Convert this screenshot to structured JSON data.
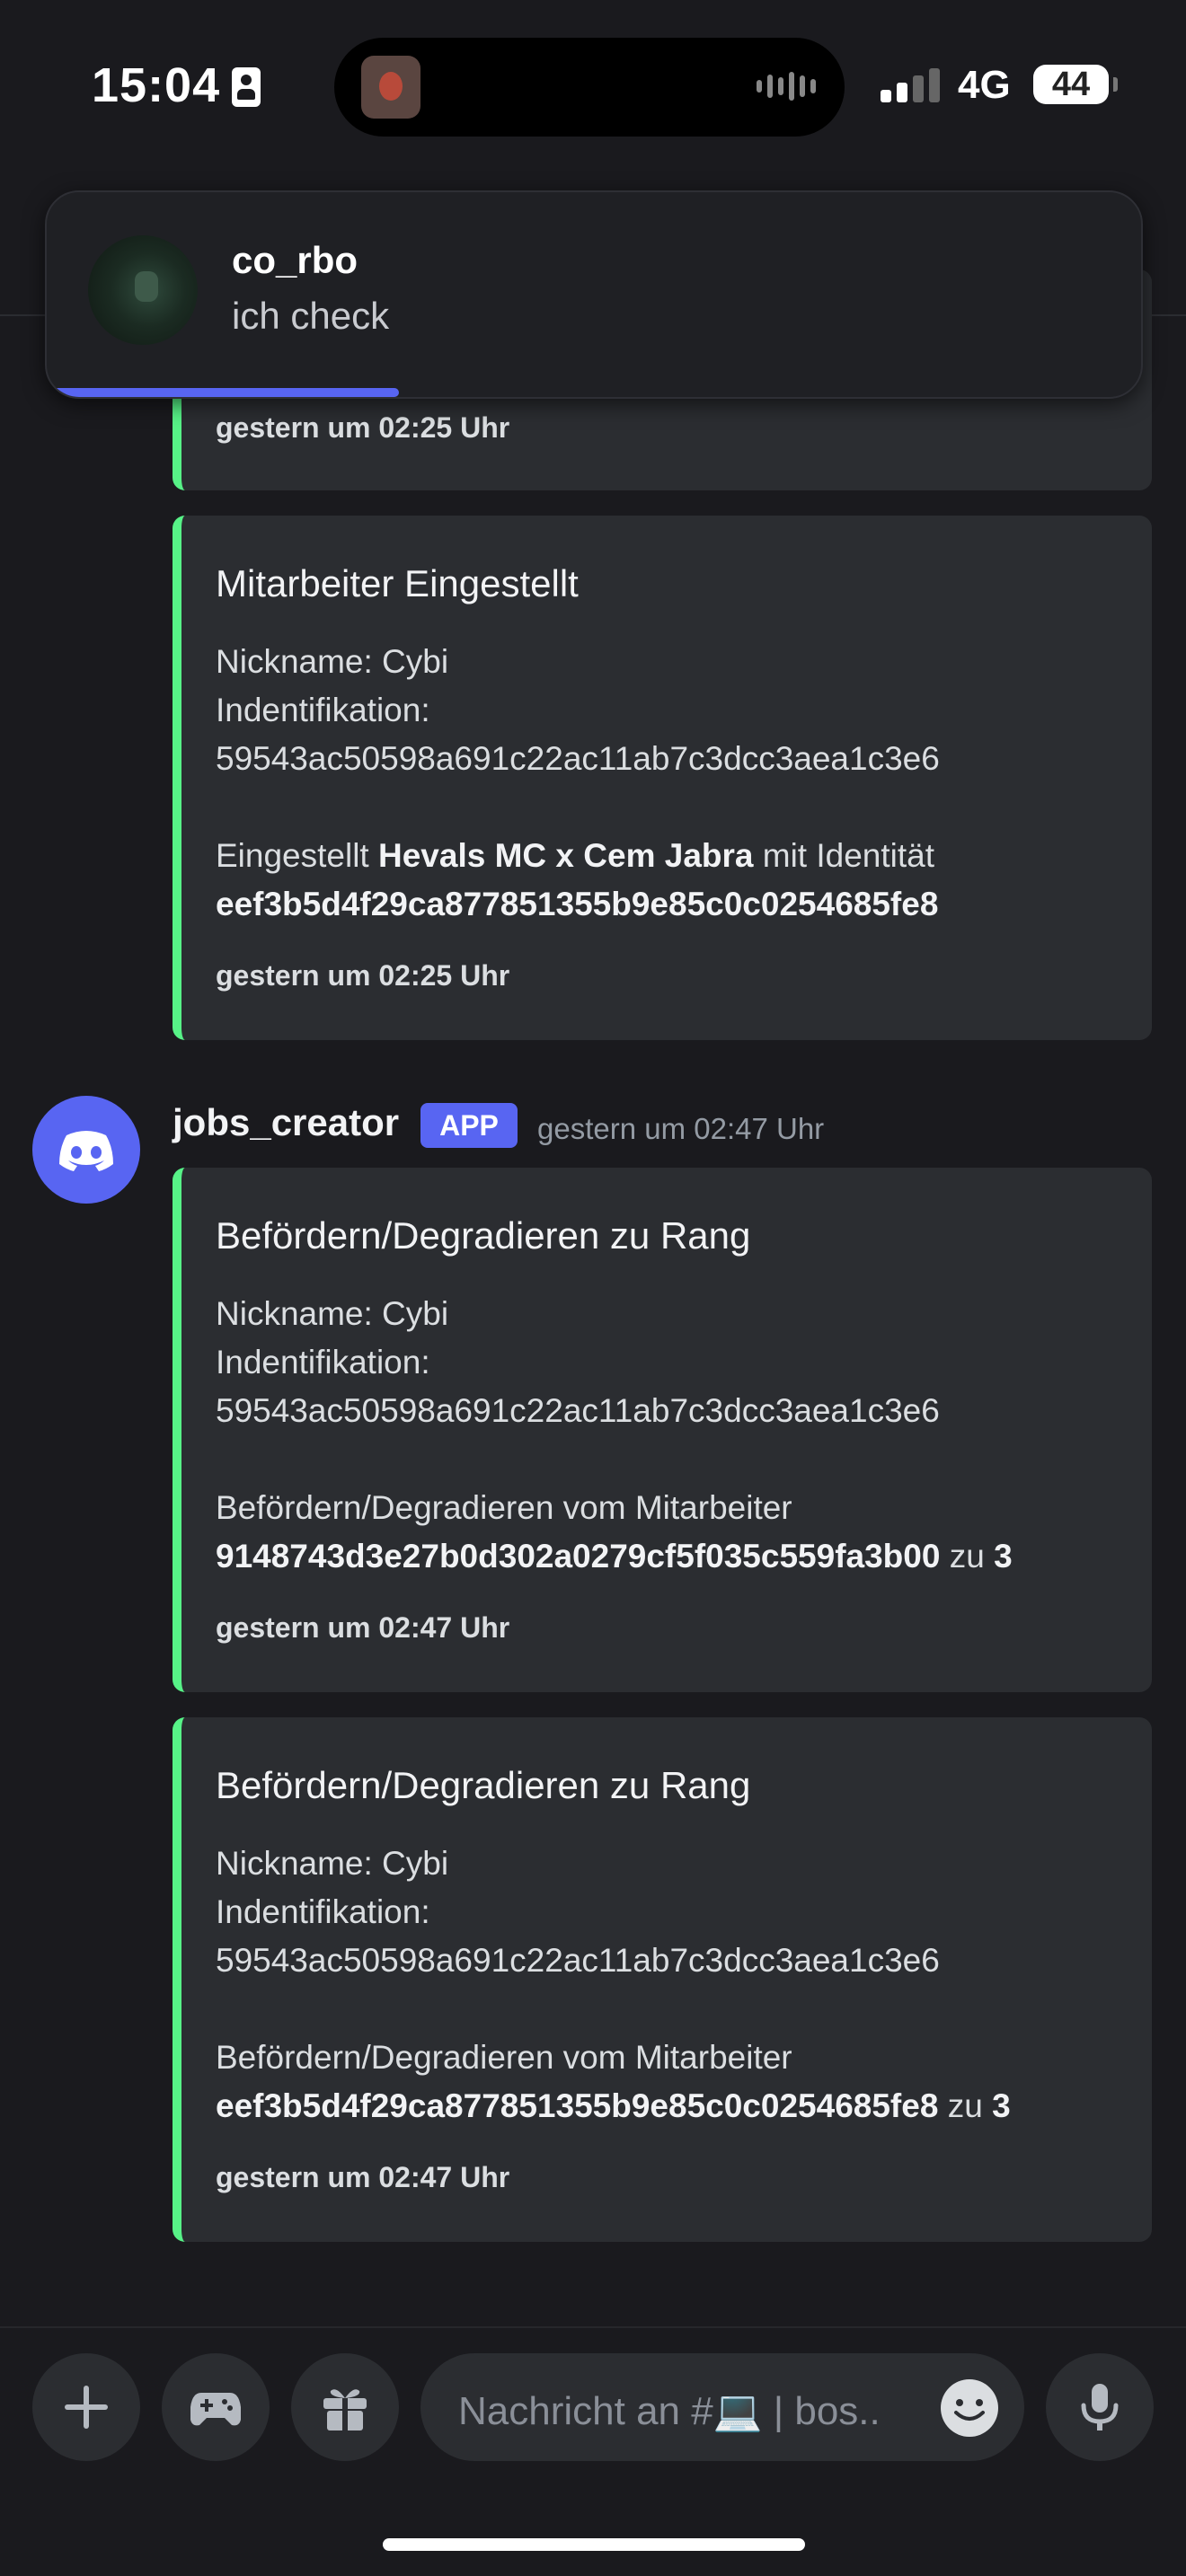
{
  "status_bar": {
    "time": "15:04",
    "network": "4G",
    "battery": "44"
  },
  "notification": {
    "sender": "co_rbo",
    "message": "ich check"
  },
  "partial_embed": {
    "timestamp": "gestern um 02:25 Uhr"
  },
  "embed1": {
    "title": "Mitarbeiter Eingestellt",
    "nickname": "Nickname: Cybi",
    "ident_label": "Indentifikation:",
    "ident_value": "59543ac50598a691c22ac11ab7c3dcc3aea1c3e6",
    "action_prefix": "Eingestellt ",
    "action_bold": "Hevals MC x Cem Jabra",
    "action_suffix": " mit Identität",
    "action_id": "eef3b5d4f29ca877851355b9e85c0c0254685fe8",
    "timestamp": "gestern um 02:25 Uhr"
  },
  "message": {
    "author": "jobs_creator",
    "badge": "APP",
    "timestamp": "gestern um 02:47 Uhr"
  },
  "embed2": {
    "title": "Befördern/Degradieren zu Rang",
    "nickname": "Nickname: Cybi",
    "ident_label": "Indentifikation:",
    "ident_value": "59543ac50598a691c22ac11ab7c3dcc3aea1c3e6",
    "action_text": "Befördern/Degradieren vom Mitarbeiter",
    "action_id": "9148743d3e27b0d302a0279cf5f035c559fa3b00",
    "action_zu": " zu ",
    "rank": "3",
    "timestamp": "gestern um 02:47 Uhr"
  },
  "embed3": {
    "title": "Befördern/Degradieren zu Rang",
    "nickname": "Nickname: Cybi",
    "ident_label": "Indentifikation:",
    "ident_value": "59543ac50598a691c22ac11ab7c3dcc3aea1c3e6",
    "action_text": "Befördern/Degradieren vom Mitarbeiter",
    "action_id": "eef3b5d4f29ca877851355b9e85c0c0254685fe8",
    "action_zu": " zu ",
    "rank": "3",
    "timestamp": "gestern um 02:47 Uhr"
  },
  "composer": {
    "placeholder": "Nachricht an #💻 | bos.."
  },
  "colors": {
    "embed_accent": "#57f287",
    "blurple": "#5865f2",
    "background": "#1a1a1e",
    "embed_bg": "#2b2d31"
  },
  "icons": [
    "plus-icon",
    "gamepad-icon",
    "gift-icon",
    "emoji-icon",
    "microphone-icon",
    "discord-logo-icon"
  ]
}
